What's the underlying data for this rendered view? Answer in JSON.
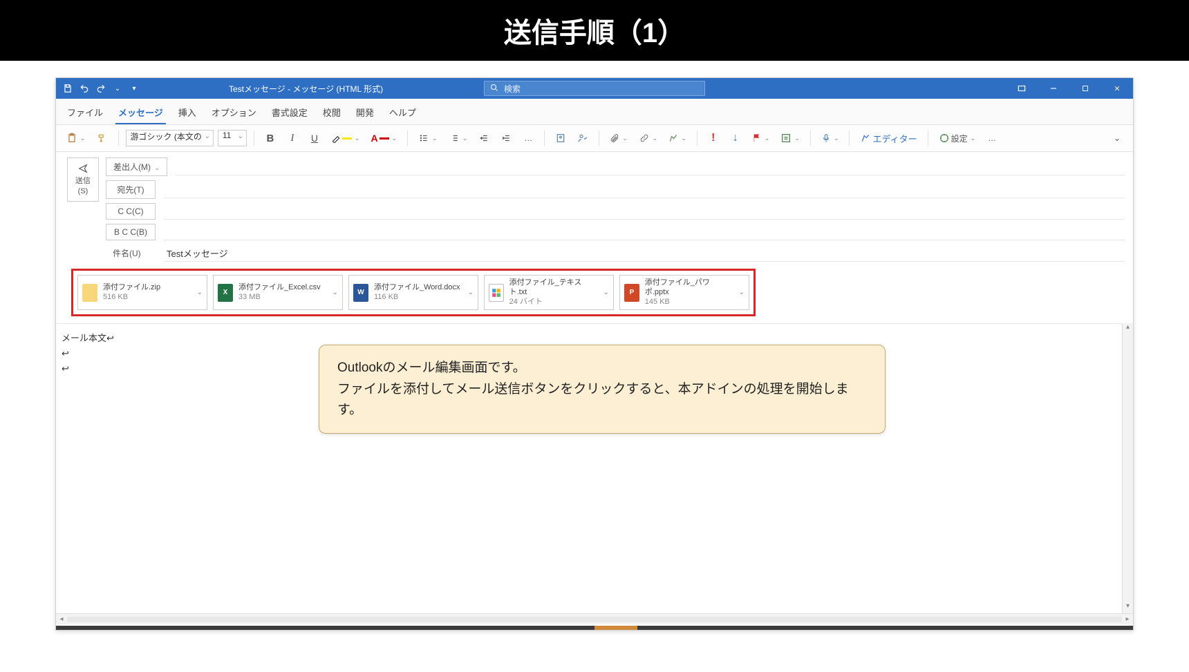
{
  "slide": {
    "title": "送信手順（1）"
  },
  "titlebar": {
    "doc_title": "Testメッセージ - メッセージ (HTML 形式)",
    "search_placeholder": "検索"
  },
  "ribbon_tabs": {
    "file": "ファイル",
    "message": "メッセージ",
    "insert": "挿入",
    "options": "オプション",
    "format": "書式設定",
    "review": "校閲",
    "develop": "開発",
    "help": "ヘルプ"
  },
  "toolbar": {
    "font_name": "游ゴシック (本文の",
    "font_size": "11",
    "bold": "B",
    "italic": "I",
    "underline": "U",
    "more": "…",
    "editor": "エディター",
    "settings": "設定"
  },
  "compose": {
    "send_label": "送信",
    "send_short": "(S)",
    "from_label": "差出人(M)",
    "to_label": "宛先(T)",
    "cc_label": "C C(C)",
    "bcc_label": "B C C(B)",
    "subject_label": "件名(U)",
    "subject_value": "Testメッセージ"
  },
  "attachments": [
    {
      "name": "添付ファイル.zip",
      "size": "516 KB",
      "kind": "zip"
    },
    {
      "name": "添付ファイル_Excel.csv",
      "size": "33 MB",
      "kind": "xls"
    },
    {
      "name": "添付ファイル_Word.docx",
      "size": "116 KB",
      "kind": "doc"
    },
    {
      "name": "添付ファイル_テキスト.txt",
      "size": "24 バイト",
      "kind": "txt"
    },
    {
      "name": "添付ファイル_パワポ.pptx",
      "size": "145 KB",
      "kind": "ppt"
    }
  ],
  "body": {
    "line1": "メール本文↩",
    "line2": "↩",
    "line3": "↩"
  },
  "callout": {
    "line1": "Outlookのメール編集画面です。",
    "line2": "ファイルを添付してメール送信ボタンをクリックすると、本アドインの処理を開始します。"
  }
}
